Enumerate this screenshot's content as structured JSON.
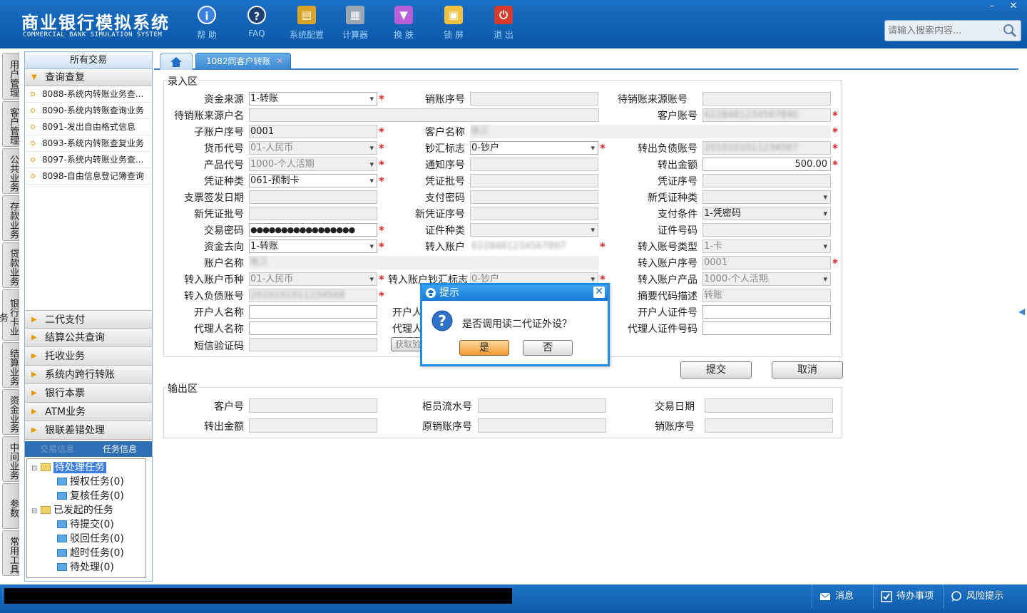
{
  "app": {
    "title_cn": "商业银行模拟系统",
    "title_en": "COMMERCIAL BANK SIMULATION SYSTEM"
  },
  "toolbar": [
    {
      "label": "帮 助",
      "icon": "info-icon"
    },
    {
      "label": "FAQ",
      "icon": "question-icon"
    },
    {
      "label": "系统配置",
      "icon": "toolbox-icon"
    },
    {
      "label": "计算器",
      "icon": "calculator-icon"
    },
    {
      "label": "换 肤",
      "icon": "shirt-icon"
    },
    {
      "label": "锁 屏",
      "icon": "lock-icon"
    },
    {
      "label": "退 出",
      "icon": "power-icon"
    }
  ],
  "search": {
    "placeholder": "请输入搜索内容..."
  },
  "vtabs": [
    "用户管理",
    "客户管理",
    "公共业务",
    "存款业务",
    "贷款业务",
    "银行卡业务",
    "结算业务",
    "资金业务",
    "中间业务",
    "参数",
    "常用工具"
  ],
  "sidebar": {
    "header": "所有交易",
    "open_category": "查询查复",
    "items": [
      "8088-系统内转账业务查...",
      "8090-系统内转账查询业务",
      "8091-发出自由格式信息",
      "8093-系统内转账查复业务",
      "8097-系统内转账业务查...",
      "8098-自由信息登记簿查询"
    ],
    "categories": [
      "二代支付",
      "结算公共查询",
      "托收业务",
      "系统内跨行转账",
      "银行本票",
      "ATM业务",
      "银联差错处理"
    ],
    "bottom_tabs": [
      "交易信息",
      "任务信息"
    ],
    "tree": {
      "pending": "待处理任务",
      "auth": "授权任务(0)",
      "review": "复核任务(0)",
      "started": "已发起的任务",
      "to_submit": "待提交(0)",
      "rejected": "驳回任务(0)",
      "timeout": "超时任务(0)",
      "todo": "待处理(0)"
    }
  },
  "tabs": {
    "active": "1082同客户转账"
  },
  "form": {
    "input_legend": "录入区",
    "output_legend": "输出区",
    "labels": {
      "fund_source": "资金来源",
      "writeoff_no": "销账序号",
      "pending_src_acct": "待销账来源账号",
      "pending_src_name": "待销账来源户名",
      "cust_acct": "客户账号",
      "sub_acct_no": "子账户序号",
      "cust_name": "客户名称",
      "currency": "货币代号",
      "cash_flag": "钞汇标志",
      "out_liab_acct": "转出负债账号",
      "product": "产品代号",
      "notice_no": "通知序号",
      "out_amount": "转出金额",
      "voucher_type": "凭证种类",
      "voucher_batch": "凭证批号",
      "voucher_no": "凭证序号",
      "cheque_date": "支票签发日期",
      "pay_pwd": "支付密码",
      "new_voucher_type": "新凭证种类",
      "new_voucher_batch": "新凭证批号",
      "new_voucher_no": "新凭证序号",
      "pay_cond": "支付条件",
      "txn_pwd": "交易密码",
      "id_type": "证件种类",
      "id_no": "证件号码",
      "fund_dest": "资金去向",
      "in_acct": "转入账户",
      "in_acct_type": "转入账号类型",
      "acct_name": "账户名称",
      "in_sub_no": "转入账户序号",
      "in_currency": "转入账户币种",
      "in_cash_flag": "转入账户钞汇标志",
      "in_product": "转入账户产品",
      "in_liab_acct": "转入负债账号",
      "summary_desc": "摘要代码描述",
      "opener_name": "开户人名称",
      "opener_id_type": "开户人",
      "opener_id_no": "开户人证件号",
      "agent_name": "代理人名称",
      "agent_id_type": "代理人",
      "agent_id_no": "代理人证件号码",
      "sms_code": "短信验证码",
      "get_code": "获取验"
    },
    "values": {
      "fund_source": "1-转账",
      "pending_src_name": "",
      "cust_acct": "6228481234567890",
      "sub_acct_no": "0001",
      "cust_name": "张三",
      "currency": "01-人民币",
      "cash_flag": "0-钞户",
      "out_liab_acct": "2010101011234567",
      "product": "1000-个人活期",
      "out_amount": "500.00",
      "voucher_type": "061-预制卡",
      "pay_cond": "1-凭密码",
      "txn_pwd": "●●●●●●●●●●●●●●●●●",
      "fund_dest": "1-转账",
      "in_acct": "6228481234567897",
      "in_acct_type": "1-卡",
      "acct_name": "张三",
      "in_sub_no": "0001",
      "in_currency": "01-人民币",
      "in_cash_flag": "0-钞户",
      "in_product": "1000-个人活期",
      "in_liab_acct": "2010101011234568",
      "summary_desc": "转账"
    },
    "output_labels": {
      "cust_no": "客户号",
      "teller_serial": "柜员流水号",
      "txn_date": "交易日期",
      "out_amount": "转出金额",
      "orig_writeoff": "原销账序号",
      "writeoff_no": "销账序号"
    },
    "submit": "提交",
    "cancel": "取消"
  },
  "dialog": {
    "title": "提示",
    "message": "是否调用读二代证外设？",
    "yes": "是",
    "no": "否"
  },
  "statusbar": {
    "messages": "消息",
    "todo": "待办事项",
    "risk": "风险提示"
  }
}
